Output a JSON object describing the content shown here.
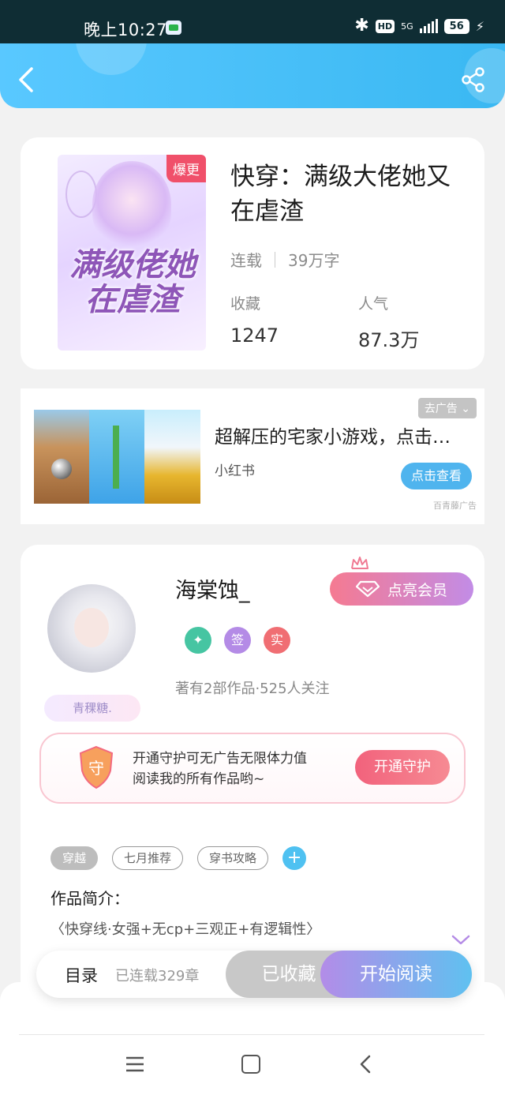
{
  "status_bar": {
    "time": "晚上10:27",
    "network": "5G",
    "hd": "HD",
    "battery": "56"
  },
  "icons": {
    "back": "back-arrow-icon",
    "share": "share-icon",
    "bluetooth": "bluetooth-icon",
    "crown": "crown-icon",
    "diamond": "diamond-icon",
    "guard": "shield-icon",
    "expand": "chevron-down-icon"
  },
  "book": {
    "cover_title": "满级佬她在虐渣",
    "hot_badge": "爆更",
    "title": "快穿：满级大佬她又在虐渣",
    "status": "连载",
    "word_count": "39万字",
    "favorites_label": "收藏",
    "favorites_value": "1247",
    "popularity_label": "人气",
    "popularity_value": "87.3万"
  },
  "ad": {
    "title": "超解压的宅家小游戏，点击查看",
    "source": "小红书",
    "close_label": "去广告 ⌄",
    "button_label": "点击查看",
    "provider": "百青藤广告"
  },
  "author": {
    "name": "海棠蚀_",
    "avatar_tag": "青稞糖.",
    "vip_button": "点亮会员",
    "badges": [
      "",
      "签",
      "实"
    ],
    "stats": "著有2部作品·525人关注",
    "guard_icon_text": "守",
    "guard_line1": "开通守护可无广告无限体力值",
    "guard_line2": "阅读我的所有作品哟~",
    "guard_button": "开通守护"
  },
  "tags": [
    "穿越",
    "七月推荐",
    "穿书攻略"
  ],
  "intro": {
    "label": "作品简介：",
    "text": "〈快穿线·女强+无cp+三观正+有逻辑性〉"
  },
  "read_bar": {
    "toc_label": "目录",
    "toc_count": "已连载329章",
    "collected_label": "已收藏",
    "start_label": "开始阅读"
  },
  "colors": {
    "header_blue": "#3ab8f2",
    "hot_red": "#f0506a",
    "vip_gradient_start": "#f57a91",
    "vip_gradient_end": "#c28ce6",
    "start_gradient_start": "#b38ce8",
    "start_gradient_end": "#5fc1f0"
  }
}
